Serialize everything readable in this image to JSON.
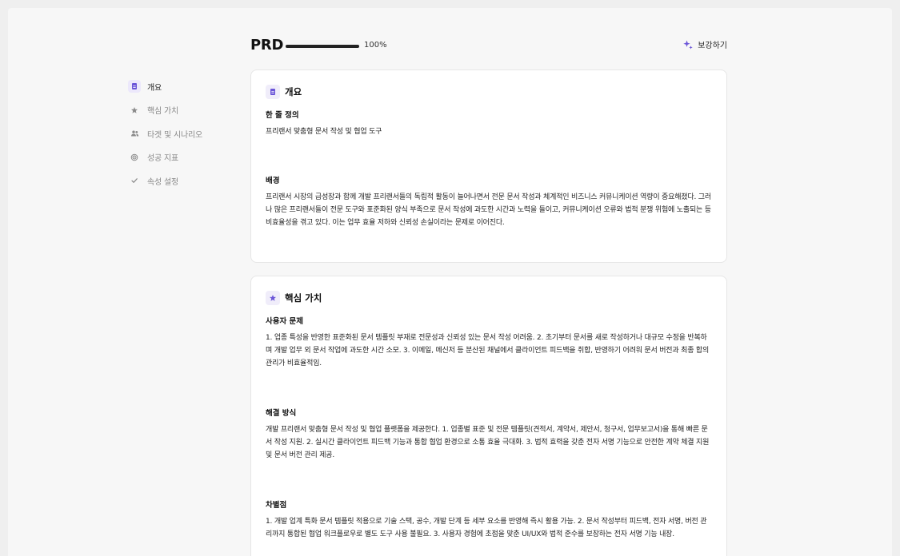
{
  "header": {
    "title": "PRD",
    "progress_percent": 100,
    "progress_label": "100%",
    "enhance_label": "보강하기"
  },
  "sidebar": {
    "items": [
      {
        "label": "개요",
        "icon": "document-icon",
        "active": true
      },
      {
        "label": "핵심 가치",
        "icon": "star-icon",
        "active": false
      },
      {
        "label": "타겟 및 시나리오",
        "icon": "users-icon",
        "active": false
      },
      {
        "label": "성공 지표",
        "icon": "target-icon",
        "active": false
      },
      {
        "label": "속성 설정",
        "icon": "check-icon",
        "active": false
      }
    ]
  },
  "overview": {
    "title": "개요",
    "one_liner_label": "한 줄 정의",
    "one_liner_text": "프리랜서 맞춤형 문서 작성 및 협업 도구",
    "background_label": "배경",
    "background_text": "프리랜서 시장의 급성장과 함께 개발 프리랜서들의 독립적 활동이 늘어나면서 전문 문서 작성과 체계적인 비즈니스 커뮤니케이션 역량이 중요해졌다. 그러나 많은 프리랜서들이 전문 도구와 표준화된 양식 부족으로 문서 작성에 과도한 시간과 노력을 들이고, 커뮤니케이션 오류와 법적 분쟁 위험에 노출되는 등 비효율성을 겪고 있다. 이는 업무 효율 저하와 신뢰성 손실이라는 문제로 이어진다."
  },
  "core_value": {
    "title": "핵심 가치",
    "problem_label": "사용자 문제",
    "problem_text": "1. 업종 특성을 반영한 표준화된 문서 템플릿 부재로 전문성과 신뢰성 있는 문서 작성 어려움. 2. 초기부터 문서를 새로 작성하거나 대규모 수정을 반복하며 개발 업무 외 문서 작업에 과도한 시간 소모. 3. 이메일, 메신저 등 분산된 채널에서 클라이언트 피드백을 취합, 반영하기 어려워 문서 버전과 최종 합의 관리가 비효율적임.",
    "solution_label": "해결 방식",
    "solution_text": "개발 프리랜서 맞춤형 문서 작성 및 협업 플랫폼을 제공한다. 1. 업종별 표준 및 전문 템플릿(견적서, 계약서, 제안서, 청구서, 업무보고서)을 통해 빠른 문서 작성 지원. 2. 실시간 클라이언트 피드백 기능과 통합 협업 환경으로 소통 효율 극대화. 3. 법적 효력을 갖춘 전자 서명 기능으로 안전한 계약 체결 지원 및 문서 버전 관리 제공.",
    "diff_label": "차별점",
    "diff_text": "1. 개발 업계 특화 문서 템플릿 적용으로 기술 스택, 공수, 개발 단계 등 세부 요소를 반영해 즉시 활용 가능. 2. 문서 작성부터 피드백, 전자 서명, 버전 관리까지 통합된 협업 워크플로우로 별도 도구 사용 불필요. 3. 사용자 경험에 초점을 맞춘 UI/UX와 법적 준수를 보장하는 전자 서명 기능 내장."
  },
  "colors": {
    "accent": "#6b55d8",
    "accent_bg": "#ece8fb",
    "progress_fill": "#222222"
  }
}
